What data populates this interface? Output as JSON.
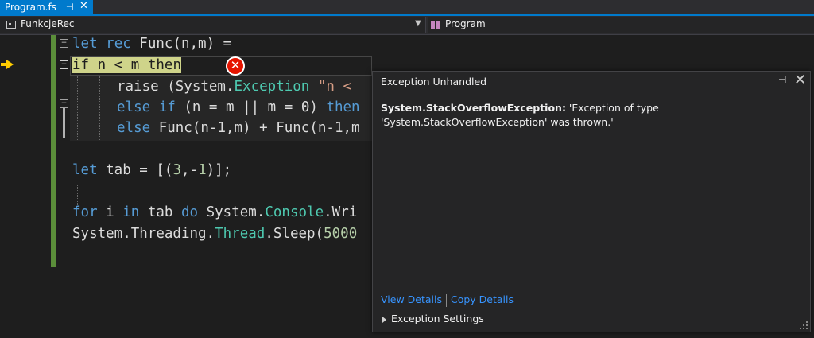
{
  "tab": {
    "title": "Program.fs",
    "pin_glyph": "⊣",
    "close_glyph": "✕"
  },
  "nav": {
    "left_label": "FunkcjeRec",
    "right_label": "Program"
  },
  "code": {
    "l1_kw1": "let",
    "l1_kw2": "rec",
    "l1_rest": " Func(n,m) =",
    "l2_kw": "if",
    "l2_mid": " n < m ",
    "l2_kw2": "then",
    "l3_a": "raise (System.",
    "l3_type": "Exception",
    "l3_sp": " ",
    "l3_str": "\"n <",
    "l4_kw1": "else",
    "l4_sp": " ",
    "l4_kw2": "if",
    "l4_rest": " (n = m || m = 0) ",
    "l4_kw3": "then",
    "l5_kw": "else",
    "l5_rest": " Func(n-1,m) + Func(n-1,m",
    "l6_kw": "let",
    "l6_a": " tab = [(",
    "l6_n1": "3",
    "l6_b": ",-",
    "l6_n2": "1",
    "l6_c": ")];",
    "l7_kw1": "for",
    "l7_a": " i ",
    "l7_kw2": "in",
    "l7_b": " tab ",
    "l7_kw3": "do",
    "l7_c": " System.",
    "l7_type": "Console",
    "l7_d": ".Wri",
    "l8_a": "System.Threading.",
    "l8_type": "Thread",
    "l8_b": ".Sleep(",
    "l8_num": "5000"
  },
  "exception": {
    "title": "Exception Unhandled",
    "type": "System.StackOverflowException:",
    "message": " 'Exception of type 'System.StackOverflowException' was thrown.'",
    "view_details": "View Details",
    "copy_details": "Copy Details",
    "settings": "Exception Settings",
    "pin_glyph": "⊣",
    "close_glyph": "✕"
  },
  "colors": {
    "accent": "#007acc",
    "keyword": "#569cd6",
    "type": "#4ec9b0",
    "string": "#d69d85",
    "number": "#b5cea8",
    "error": "#e51400",
    "exec_highlight": "#cfd48a"
  }
}
